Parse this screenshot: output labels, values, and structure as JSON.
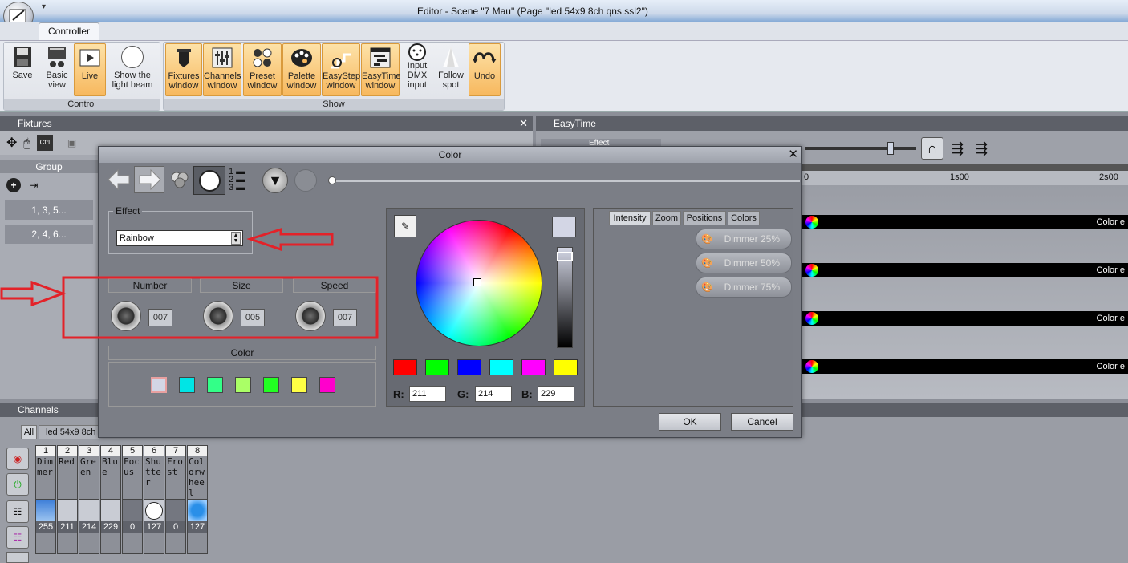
{
  "window": {
    "title": "Editor - Scene \"7 Mau\" (Page \"led 54x9 8ch qns.ssl2\")"
  },
  "ribbon": {
    "tab": "Controller",
    "control_group_label": "Control",
    "show_group_label": "Show",
    "buttons": {
      "save": "Save",
      "basic_view": [
        "Basic",
        "view"
      ],
      "live": "Live",
      "light_beam": [
        "Show the",
        "light beam"
      ],
      "fixtures": [
        "Fixtures",
        "window"
      ],
      "channels": [
        "Channels",
        "window"
      ],
      "preset": [
        "Preset",
        "window"
      ],
      "palette": [
        "Palette",
        "window"
      ],
      "easystep": [
        "EasyStep",
        "window"
      ],
      "easytime": [
        "EasyTime",
        "window"
      ],
      "dmx_input": [
        "Input",
        "DMX",
        "input"
      ],
      "follow_spot": [
        "Follow",
        "spot"
      ],
      "undo": "Undo"
    }
  },
  "fixtures_panel": {
    "title": "Fixtures",
    "group_header": "Group",
    "groups": [
      "1, 3, 5...",
      "2, 4, 6..."
    ]
  },
  "easytime_panel": {
    "title": "EasyTime",
    "effect_field": "Effect",
    "ruler": [
      "0",
      "1s00",
      "2s00"
    ],
    "tracks": [
      "Color e",
      "Color e",
      "Color e",
      "Color e"
    ]
  },
  "channels_panel": {
    "title": "Channels",
    "tabs": [
      "All",
      "led 54x9 8ch"
    ],
    "channels": [
      {
        "num": "1",
        "name": "Dimmer",
        "value": "255"
      },
      {
        "num": "2",
        "name": "Red",
        "value": "211"
      },
      {
        "num": "3",
        "name": "Green",
        "value": "214"
      },
      {
        "num": "4",
        "name": "Blue",
        "value": "229"
      },
      {
        "num": "5",
        "name": "Focus",
        "value": "0"
      },
      {
        "num": "6",
        "name": "Shutter",
        "value": "127"
      },
      {
        "num": "7",
        "name": "Frost",
        "value": "0"
      },
      {
        "num": "8",
        "name": "Colorwheel",
        "value": "127"
      }
    ]
  },
  "color_dialog": {
    "title": "Color",
    "effect_label": "Effect",
    "effect_value": "Rainbow",
    "params": [
      {
        "label": "Number",
        "value": "007"
      },
      {
        "label": "Size",
        "value": "005"
      },
      {
        "label": "Speed",
        "value": "007"
      }
    ],
    "color_label": "Color",
    "effect_swatches": [
      "#d3d6e5",
      "#00e5e5",
      "#33ff88",
      "#aaff66",
      "#22ff22",
      "#ffff44",
      "#ff00cc"
    ],
    "preset_swatches": [
      "#ff0000",
      "#00ff00",
      "#0000ff",
      "#00ffff",
      "#ff00ff",
      "#ffff00"
    ],
    "rgb": {
      "r_label": "R:",
      "r": "211",
      "g_label": "G:",
      "g": "214",
      "b_label": "B:",
      "b": "229"
    },
    "side_tabs": [
      "Intensity",
      "Zoom",
      "Positions",
      "Colors"
    ],
    "dimmer_buttons": [
      "Dimmer 25%",
      "Dimmer 50%",
      "Dimmer 75%"
    ],
    "ok": "OK",
    "cancel": "Cancel"
  },
  "colors": {
    "annotation_red": "#e32229",
    "ribbon_active": "#f7b85e"
  }
}
